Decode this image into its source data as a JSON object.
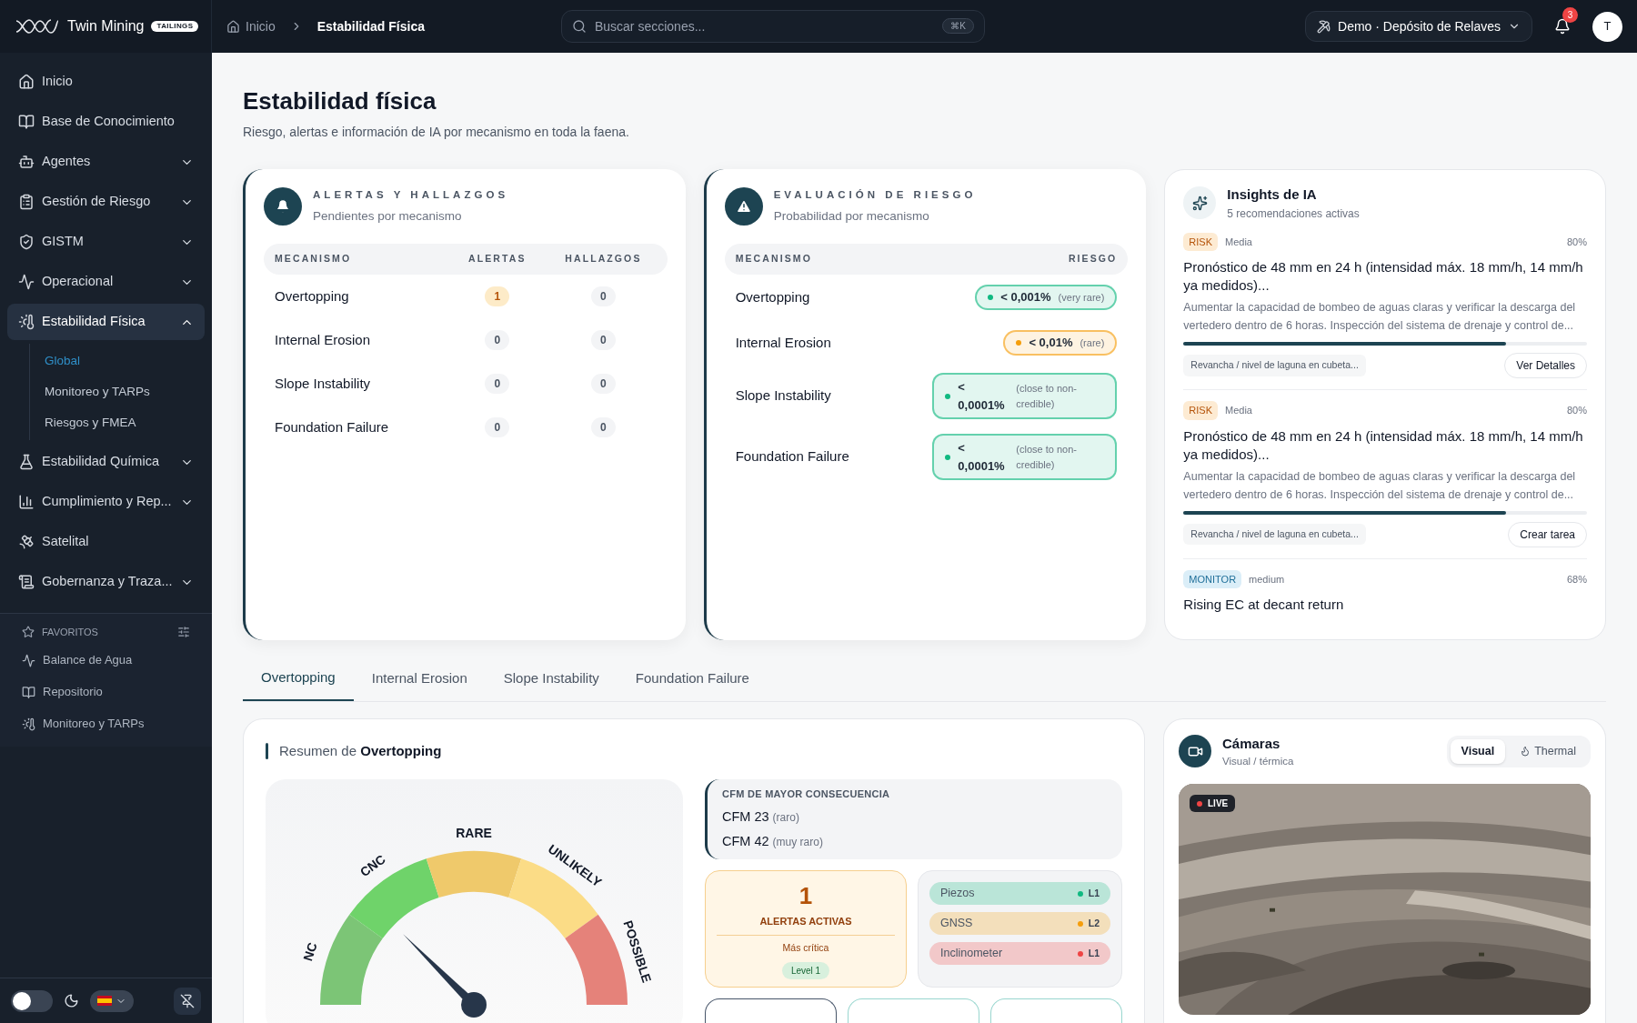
{
  "header": {
    "brand": {
      "name": "Twin Mining",
      "tag": "TAILINGS"
    },
    "breadcrumb": [
      {
        "label": "Inicio",
        "current": false
      },
      {
        "label": "Estabilidad Física",
        "current": true
      }
    ],
    "search": {
      "placeholder": "Buscar secciones...",
      "shortcut": "⌘K"
    },
    "site": "Demo · Depósito de Relaves",
    "notifications": "3",
    "avatar": "T"
  },
  "sidebar": {
    "items": [
      {
        "label": "Inicio",
        "kind": "link",
        "selected": false
      },
      {
        "label": "Base de Conocimiento",
        "kind": "link",
        "selected": false
      },
      {
        "label": "Agentes",
        "kind": "group",
        "expanded": false,
        "selected": false
      },
      {
        "label": "Gestión de Riesgo",
        "kind": "group",
        "expanded": false,
        "selected": false
      },
      {
        "label": "GISTM",
        "kind": "group",
        "expanded": false,
        "selected": false
      },
      {
        "label": "Operacional",
        "kind": "group",
        "expanded": false,
        "selected": false
      },
      {
        "label": "Estabilidad Física",
        "kind": "group",
        "expanded": true,
        "selected": true,
        "children": [
          {
            "label": "Global",
            "selected": true
          },
          {
            "label": "Monitoreo y TARPs",
            "selected": false
          },
          {
            "label": "Riesgos y FMEA",
            "selected": false
          }
        ]
      },
      {
        "label": "Estabilidad Química",
        "kind": "group",
        "expanded": false,
        "selected": false
      },
      {
        "label": "Cumplimiento y Rep...",
        "kind": "group",
        "expanded": false,
        "selected": false
      },
      {
        "label": "Satelital",
        "kind": "link",
        "selected": false
      },
      {
        "label": "Gobernanza y Traza...",
        "kind": "group",
        "expanded": false,
        "selected": false
      }
    ],
    "favorites": {
      "title": "FAVORITOS",
      "items": [
        "Balance de Agua",
        "Repositorio",
        "Monitoreo y TARPs"
      ]
    },
    "dark_mode": false
  },
  "page": {
    "title": "Estabilidad física",
    "subtitle": "Riesgo, alertas e información de IA por mecanismo en toda la faena."
  },
  "alerts_card": {
    "title": "ALERTAS Y HALLAZGOS",
    "subtitle": "Pendientes por mecanismo",
    "columns": [
      "MECANISMO",
      "ALERTAS",
      "HALLAZGOS"
    ],
    "rows": [
      {
        "mechanism": "Overtopping",
        "alerts": "1",
        "findings": "0",
        "highlighted": true
      },
      {
        "mechanism": "Internal Erosion",
        "alerts": "0",
        "findings": "0",
        "highlighted": false
      },
      {
        "mechanism": "Slope Instability",
        "alerts": "0",
        "findings": "0",
        "highlighted": false
      },
      {
        "mechanism": "Foundation Failure",
        "alerts": "0",
        "findings": "0",
        "highlighted": false
      }
    ]
  },
  "risk_card": {
    "title": "EVALUACIÓN DE RIESGO",
    "subtitle": "Probabilidad por mecanismo",
    "columns": [
      "MECANISMO",
      "RIESGO"
    ],
    "rows": [
      {
        "mechanism": "Overtopping",
        "value": "< 0,001%",
        "label": "(very rare)",
        "color": "#10b981"
      },
      {
        "mechanism": "Internal Erosion",
        "value": "< 0,01%",
        "label": "(rare)",
        "color": "#f59e0b"
      },
      {
        "mechanism": "Slope Instability",
        "value": "< 0,0001%",
        "label": "(close to non-credible)",
        "color": "#10b981"
      },
      {
        "mechanism": "Foundation Failure",
        "value": "< 0,0001%",
        "label": "(close to non-credible)",
        "color": "#10b981"
      }
    ]
  },
  "insights": {
    "title": "Insights de IA",
    "subtitle": "5 recomendaciones activas",
    "items": [
      {
        "tag": "RISK",
        "kind": "risk",
        "priority": "Media",
        "confidence": "80%",
        "title": "Pronóstico de 48 mm en 24 h (intensidad máx. 18 mm/h, 14 mm/h ya medidos)...",
        "body": "Aumentar la capacidad de bombeo de aguas claras y verificar la descarga del vertedero dentro de 6 horas. Inspección del sistema de drenaje y control de...",
        "level": 0.8,
        "source": "Revancha / nivel de laguna en cubeta...",
        "action": "Ver Detalles"
      },
      {
        "tag": "RISK",
        "kind": "risk",
        "priority": "Media",
        "confidence": "80%",
        "title": "Pronóstico de 48 mm en 24 h (intensidad máx. 18 mm/h, 14 mm/h ya medidos)...",
        "body": "Aumentar la capacidad de bombeo de aguas claras y verificar la descarga del vertedero dentro de 6 horas. Inspección del sistema de drenaje y control de...",
        "level": 0.8,
        "source": "Revancha / nivel de laguna en cubeta...",
        "action": "Crear tarea"
      },
      {
        "tag": "MONITOR",
        "kind": "monitor",
        "priority": "medium",
        "confidence": "68%",
        "title": "Rising EC at decant return"
      }
    ]
  },
  "tabs": [
    {
      "label": "Overtopping",
      "selected": true
    },
    {
      "label": "Internal Erosion",
      "selected": false
    },
    {
      "label": "Slope Instability",
      "selected": false
    },
    {
      "label": "Foundation Failure",
      "selected": false
    }
  ],
  "summary": {
    "title": "Resumen de **Overtopping**",
    "gauge": {
      "bands": [
        {
          "label": "NC",
          "color": "#7cc576"
        },
        {
          "label": "CNC",
          "color": "#6fd36a"
        },
        {
          "label": "RARE",
          "color": "#efc96b"
        },
        {
          "label": "UNLIKELY",
          "color": "#fbdc86"
        },
        {
          "label": "POSSIBLE",
          "color": "#e5827a"
        }
      ]
    },
    "cfm": {
      "title": "CFM DE MAYOR CONSECUENCIA",
      "items": [
        {
          "name": "CFM 23",
          "note": "(raro)"
        },
        {
          "name": "CFM 42",
          "note": "(muy raro)"
        }
      ]
    },
    "active_alerts": {
      "count": "1",
      "label": "ALERTAS ACTIVAS",
      "sub": "Más crítica",
      "badge": "Level 1"
    },
    "instruments": [
      {
        "name": "Piezos",
        "level": "L1",
        "color": "#10b981"
      },
      {
        "name": "GNSS",
        "level": "L2",
        "color": "#f59e0b"
      },
      {
        "name": "Inclinometer",
        "level": "L1",
        "color": "#ef4444"
      }
    ]
  },
  "cameras": {
    "title": "Cámaras",
    "subtitle": "Visual / térmica",
    "modes": [
      {
        "label": "Visual",
        "selected": true
      },
      {
        "label": "Thermal",
        "selected": false
      }
    ],
    "live": "LIVE"
  }
}
